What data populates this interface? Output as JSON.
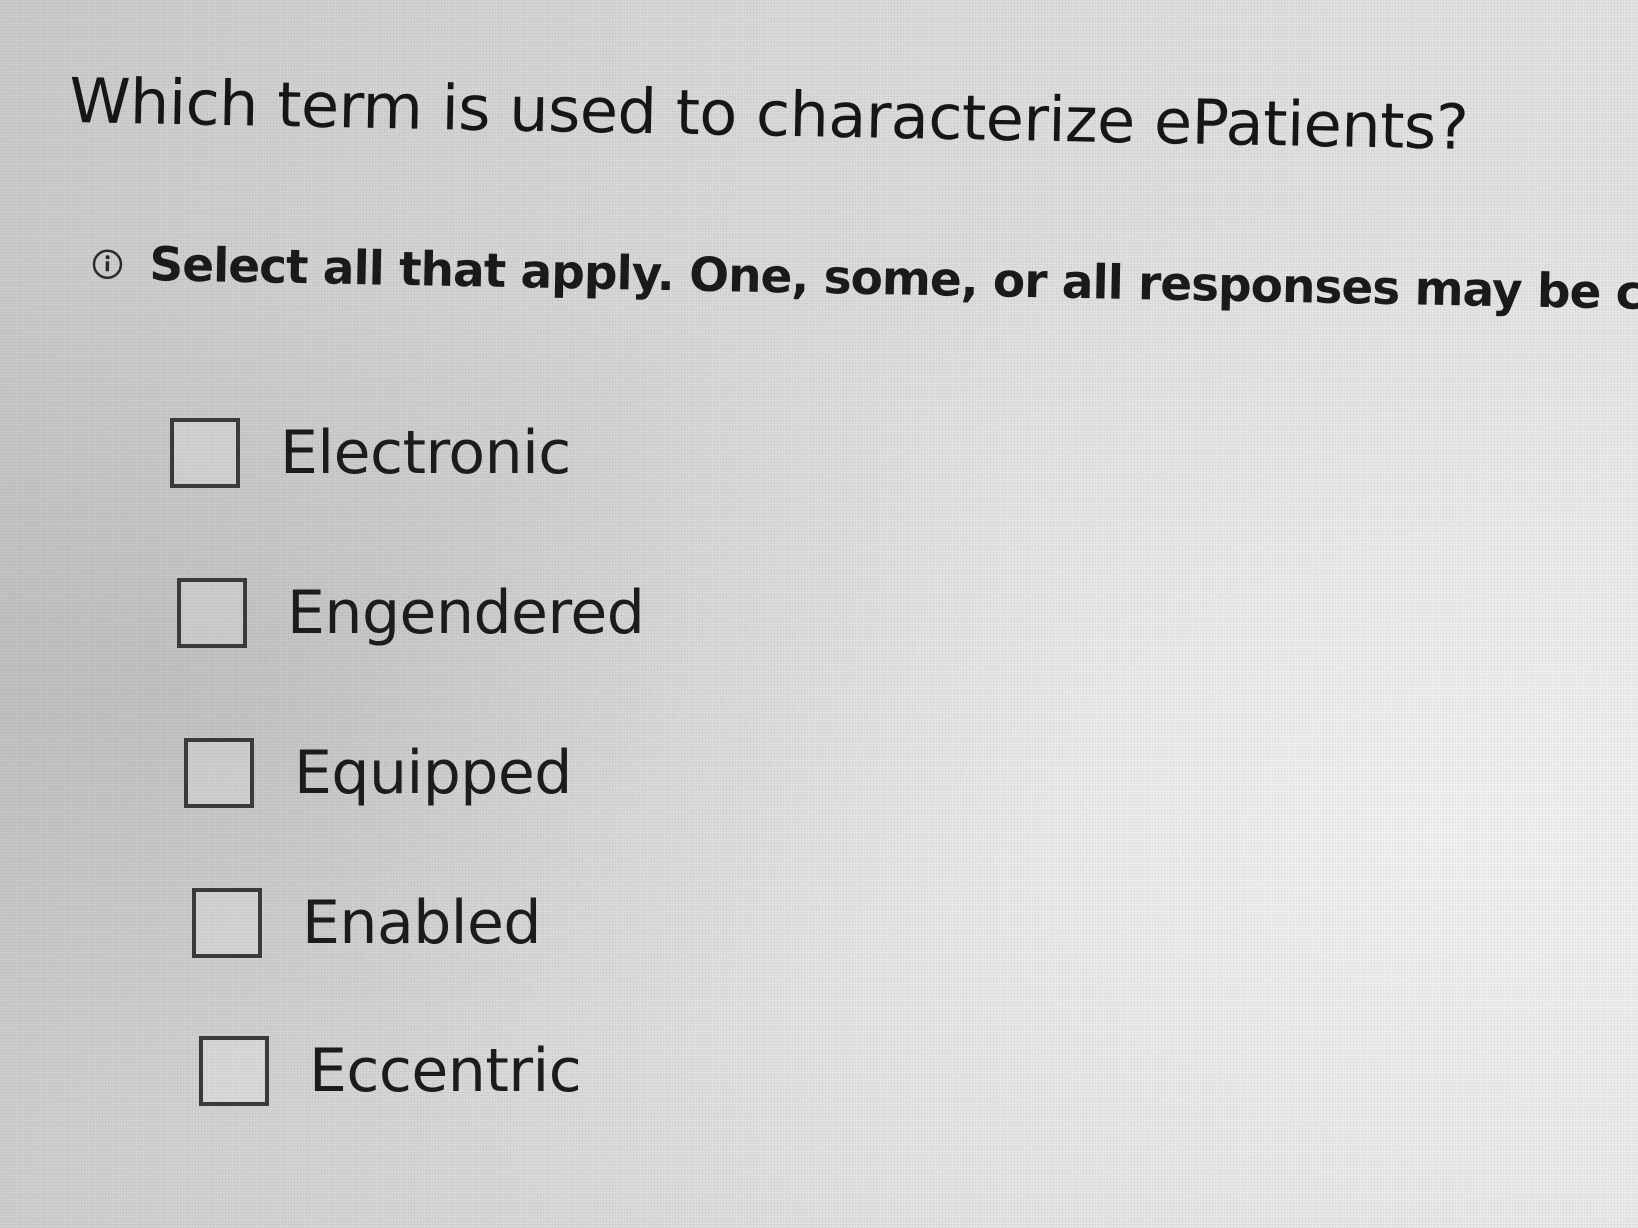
{
  "question": {
    "title": "Which term is used to characterize ePatients?",
    "instruction": "Select all that apply. One, some, or all responses may be correct.",
    "instruction_icon": "info-icon"
  },
  "options": [
    {
      "label": "Electronic",
      "checked": false
    },
    {
      "label": "Engendered",
      "checked": false
    },
    {
      "label": "Equipped",
      "checked": false
    },
    {
      "label": "Enabled",
      "checked": false
    },
    {
      "label": "Eccentric",
      "checked": false
    }
  ],
  "colors": {
    "text": "#1c1c1c",
    "checkbox_border": "#3a3a3a",
    "background": "#d8d9da"
  }
}
